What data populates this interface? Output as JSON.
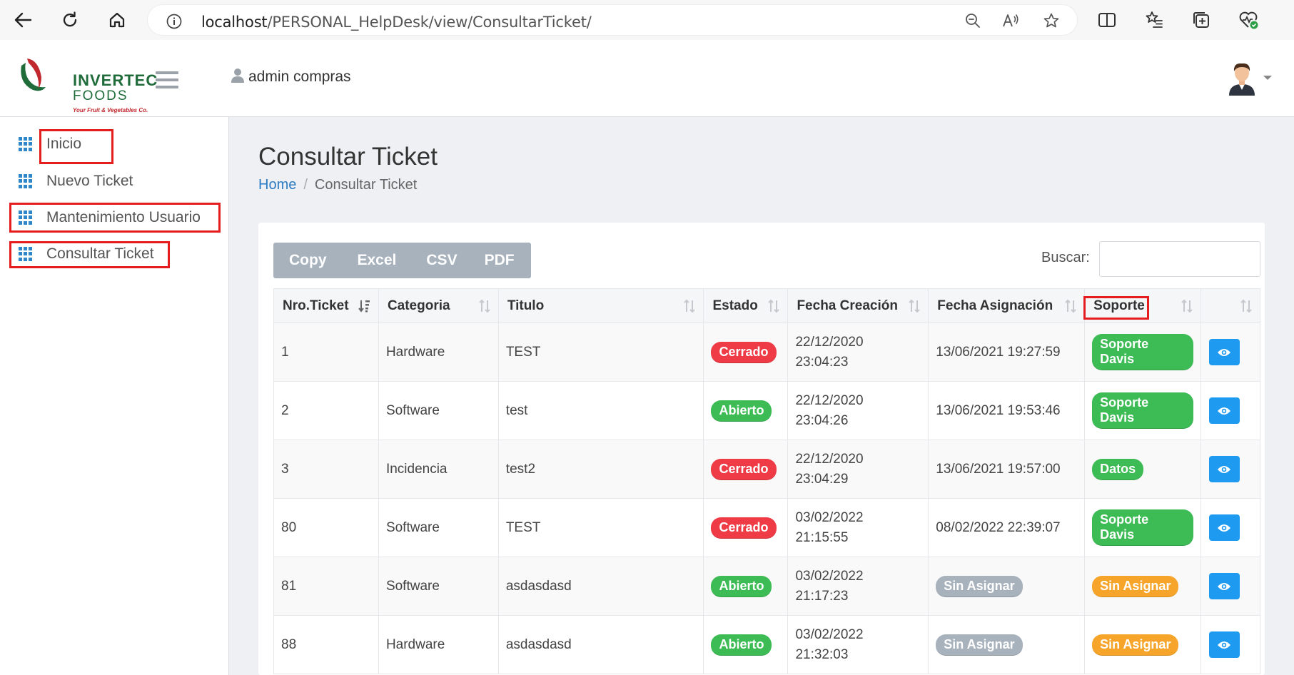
{
  "browser": {
    "url_host": "localhost",
    "url_path": "/PERSONAL_HelpDesk/view/ConsultarTicket/"
  },
  "header": {
    "brand_line1": "INVERTEC",
    "brand_line2": "FOODS",
    "brand_tagline": "Your Fruit & Vegetables Co.",
    "user_name": "admin compras"
  },
  "sidebar": {
    "items": [
      {
        "label": "Inicio"
      },
      {
        "label": "Nuevo Ticket"
      },
      {
        "label": "Mantenimiento Usuario"
      },
      {
        "label": "Consultar Ticket"
      }
    ]
  },
  "page": {
    "title": "Consultar Ticket",
    "breadcrumb_home": "Home",
    "breadcrumb_sep": "/",
    "breadcrumb_current": "Consultar Ticket"
  },
  "toolbar": {
    "copy": "Copy",
    "excel": "Excel",
    "csv": "CSV",
    "pdf": "PDF",
    "search_label": "Buscar:"
  },
  "table": {
    "headers": [
      "Nro.Ticket",
      "Categoria",
      "Titulo",
      "Estado",
      "Fecha Creación",
      "Fecha Asignación",
      "Soporte"
    ],
    "rows": [
      {
        "nro": "1",
        "categoria": "Hardware",
        "titulo": "TEST",
        "estado": "Cerrado",
        "creacion_date": "22/12/2020",
        "creacion_time": "23:04:23",
        "asignacion": "13/06/2021 19:27:59",
        "soporte": "Soporte Davis"
      },
      {
        "nro": "2",
        "categoria": "Software",
        "titulo": "test",
        "estado": "Abierto",
        "creacion_date": "22/12/2020",
        "creacion_time": "23:04:26",
        "asignacion": "13/06/2021 19:53:46",
        "soporte": "Soporte Davis"
      },
      {
        "nro": "3",
        "categoria": "Incidencia",
        "titulo": "test2",
        "estado": "Cerrado",
        "creacion_date": "22/12/2020",
        "creacion_time": "23:04:29",
        "asignacion": "13/06/2021 19:57:00",
        "soporte": "Datos"
      },
      {
        "nro": "80",
        "categoria": "Software",
        "titulo": "TEST",
        "estado": "Cerrado",
        "creacion_date": "03/02/2022",
        "creacion_time": "21:15:55",
        "asignacion": "08/02/2022 22:39:07",
        "soporte": "Soporte Davis"
      },
      {
        "nro": "81",
        "categoria": "Software",
        "titulo": "asdasdasd",
        "estado": "Abierto",
        "creacion_date": "03/02/2022",
        "creacion_time": "21:17:23",
        "asignacion": "Sin Asignar",
        "soporte": "Sin Asignar"
      },
      {
        "nro": "88",
        "categoria": "Hardware",
        "titulo": "asdasdasd",
        "estado": "Abierto",
        "creacion_date": "03/02/2022",
        "creacion_time": "21:32:03",
        "asignacion": "Sin Asignar",
        "soporte": "Sin Asignar"
      }
    ]
  },
  "colors": {
    "cerrado": "#ef3b45",
    "abierto": "#3dbb55",
    "soporte": "#3dbb55",
    "sin_asignar_fecha": "#a8b2bd",
    "sin_asignar_soporte": "#f7a52a",
    "eye_button": "#1e9bf0",
    "highlight": "#e41e1e"
  }
}
